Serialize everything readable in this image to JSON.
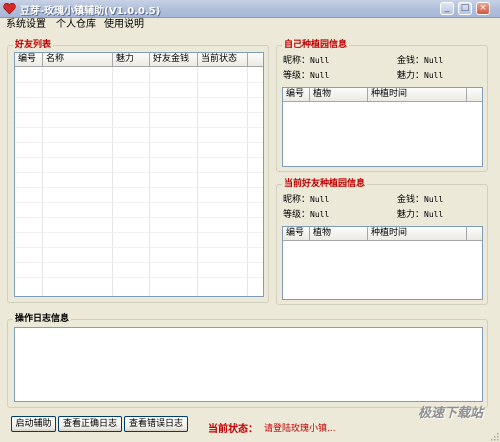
{
  "window": {
    "title": "豆芽-玫瑰小镇辅助(V1.0.0.5)"
  },
  "menu": [
    {
      "label": "系统设置"
    },
    {
      "label": "个人仓库"
    },
    {
      "label": "使用说明"
    }
  ],
  "friends": {
    "title": "好友列表",
    "columns": [
      "编号",
      "名称",
      "魅力",
      "好友金钱",
      "当前状态"
    ]
  },
  "own_garden": {
    "title": "自己种植园信息",
    "nickname_label": "昵称：",
    "nickname": "Null",
    "gold_label": "金钱：",
    "gold": "Null",
    "level_label": "等级：",
    "level": "Null",
    "charm_label": "魅力：",
    "charm": "Null",
    "columns": [
      "编号",
      "植物",
      "种植时间"
    ]
  },
  "friend_garden": {
    "title": "当前好友种植园信息",
    "nickname_label": "昵称：",
    "nickname": "Null",
    "gold_label": "金钱：",
    "gold": "Null",
    "level_label": "等级：",
    "level": "Null",
    "charm_label": "魅力：",
    "charm": "Null",
    "columns": [
      "编号",
      "植物",
      "种植时间"
    ]
  },
  "log": {
    "title": "操作日志信息"
  },
  "buttons": {
    "start": "启动辅助",
    "view_correct": "查看正确日志",
    "view_error": "查看错误日志"
  },
  "status": {
    "label": "当前状态：",
    "value": "请登陆玫瑰小镇..."
  },
  "watermark": "极速下载站",
  "colors": {
    "accent_red": "#c00000",
    "titlebar": "#b3c1dd"
  }
}
